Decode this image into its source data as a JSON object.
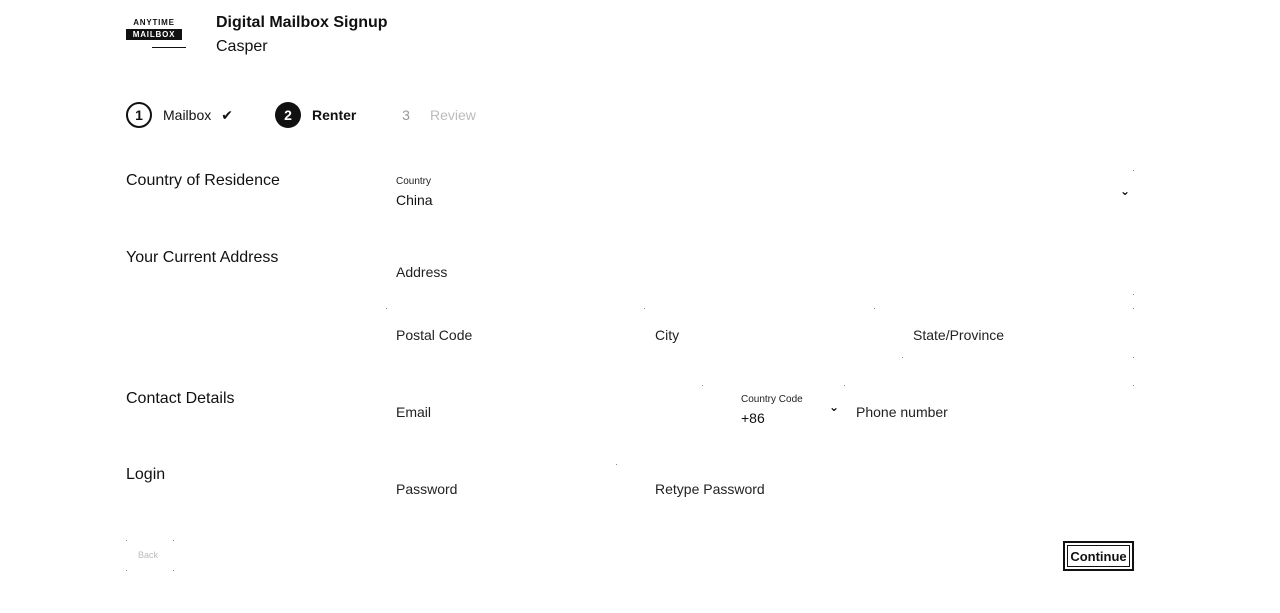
{
  "header": {
    "logo_line1": "ANYTIME",
    "logo_line2": "MAILBOX",
    "title": "Digital Mailbox Signup",
    "subtitle": "Casper"
  },
  "steps": [
    {
      "number": "1",
      "label": "Mailbox",
      "status": "complete"
    },
    {
      "number": "2",
      "label": "Renter",
      "status": "active"
    },
    {
      "number": "3",
      "label": "Review",
      "status": "upcoming"
    }
  ],
  "icons": {
    "step_complete": "checkmark-icon",
    "dropdown": "chevron-down-icon"
  },
  "sections": {
    "residence": "Country of Residence",
    "address": "Your Current Address",
    "contact": "Contact Details",
    "login": "Login"
  },
  "fields": {
    "country": {
      "label": "Country",
      "value": "China"
    },
    "address": {
      "placeholder": "Address"
    },
    "postal_code": {
      "placeholder": "Postal Code"
    },
    "city": {
      "placeholder": "City"
    },
    "state": {
      "placeholder": "State/Province"
    },
    "email": {
      "placeholder": "Email"
    },
    "country_code": {
      "label": "Country Code",
      "value": "+86"
    },
    "phone": {
      "placeholder": "Phone number"
    },
    "password": {
      "placeholder": "Password"
    },
    "retype_password": {
      "placeholder": "Retype Password"
    }
  },
  "actions": {
    "continue": "Continue",
    "back": "Back"
  }
}
